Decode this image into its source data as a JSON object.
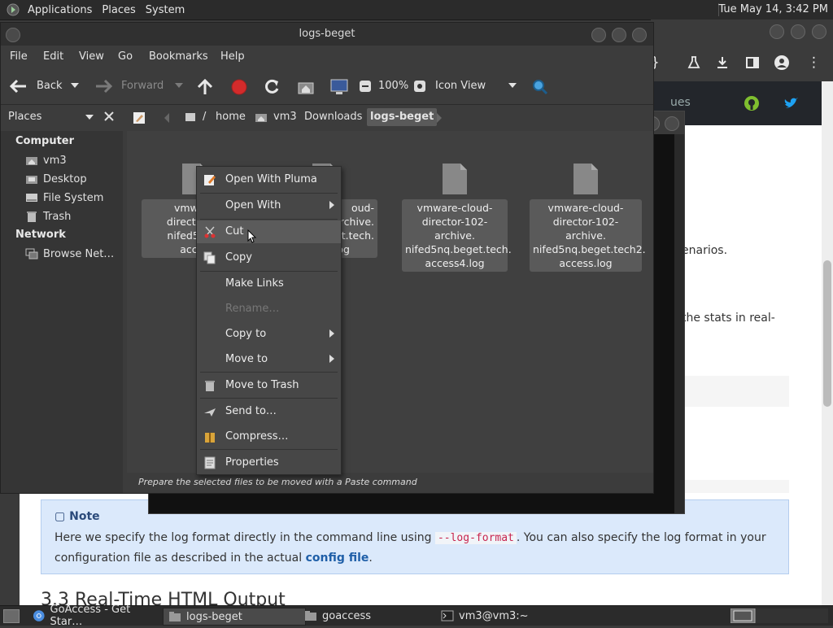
{
  "top_panel": {
    "menus": [
      "Applications",
      "Places",
      "System"
    ],
    "clock": "Tue May 14,  3:42 PM"
  },
  "browser": {
    "site_link": "ues",
    "page_text": {
      "frag1": "enarios.",
      "frag2": "the stats in real-"
    },
    "note": {
      "title": "Note",
      "line1_a": "Here we specify the log format directly in the command line using ",
      "line1_code": "--log-format",
      "line1_b": ". You can also specify the log format in your",
      "line2_a": "configuration file as described in the actual ",
      "line2_link": "config file",
      "line2_b": "."
    },
    "heading": "3.3 Real-Time HTML Output"
  },
  "file_manager": {
    "title": "logs-beget",
    "menu": [
      "File",
      "Edit",
      "View",
      "Go",
      "Bookmarks",
      "Help"
    ],
    "toolbar": {
      "back": "Back",
      "forward": "Forward",
      "zoom": "100%",
      "view_mode": "Icon View"
    },
    "sidebar_combo": "Places",
    "breadcrumbs": [
      "/",
      "home",
      "vm3",
      "Downloads",
      "logs-beget"
    ],
    "sidebar": {
      "computer_header": "Computer",
      "computer_items": [
        "vm3",
        "Desktop",
        "File System",
        "Trash"
      ],
      "network_header": "Network",
      "network_items": [
        "Browse Net…"
      ]
    },
    "files": [
      {
        "l1": "vmware-cloud-",
        "l2": "director-102-archive.",
        "l3": "nifed5nq.beget.tech.",
        "l4": "access.log"
      },
      {
        "l1": "vmware-cloud-",
        "l2": "director-102-archive.",
        "l3": "nifed5nq.beget.tech.",
        "l4": "access3.log"
      },
      {
        "l1": "vmware-cloud-",
        "l2": "director-102-archive.",
        "l3": "nifed5nq.beget.tech.",
        "l4": "access4.log"
      },
      {
        "l1": "vmware-cloud-",
        "l2": "director-102-archive.",
        "l3": "nifed5nq.beget.tech2.",
        "l4": "access.log"
      }
    ],
    "visible_file_fragments": {
      "f1": [
        "vmware",
        "director-10",
        "nifed5nq.b",
        "acces"
      ],
      "f2": [
        "oud-",
        "archive.",
        "et.tech.",
        "log"
      ]
    },
    "status": "Prepare the selected files to be moved with a Paste command"
  },
  "context_menu": {
    "items": [
      {
        "label": "Open With Pluma",
        "icon": "pluma-icon"
      },
      {
        "label": "Open With",
        "submenu": true
      },
      {
        "label": "Cut",
        "icon": "cut-icon",
        "hover": true
      },
      {
        "label": "Copy",
        "icon": "copy-icon"
      },
      {
        "label": "Make Links"
      },
      {
        "label": "Rename…",
        "disabled": true
      },
      {
        "label": "Copy to",
        "submenu": true
      },
      {
        "label": "Move to",
        "submenu": true
      },
      {
        "label": "Move to Trash",
        "icon": "trash-icon"
      },
      {
        "label": "Send to…",
        "icon": "send-icon"
      },
      {
        "label": "Compress…",
        "icon": "archive-icon"
      },
      {
        "label": "Properties",
        "icon": "properties-icon"
      }
    ]
  },
  "taskbar": {
    "tasks": [
      {
        "label": "GoAccess - Get Star…",
        "icon": "chrome-icon"
      },
      {
        "label": "logs-beget",
        "icon": "folder-icon",
        "active": true
      },
      {
        "label": "goaccess",
        "icon": "folder-icon"
      },
      {
        "label": "vm3@vm3:~",
        "icon": "terminal-icon"
      }
    ]
  },
  "colors": {
    "panel_bg": "#2b2b2b",
    "window_bg": "#3c3c3c",
    "record_red": "#d32b2b",
    "note_bg": "#dbe9fb",
    "link_blue": "#1f5fa8",
    "github_green": "#7fbf2f",
    "twitter_blue": "#1da1f2"
  }
}
